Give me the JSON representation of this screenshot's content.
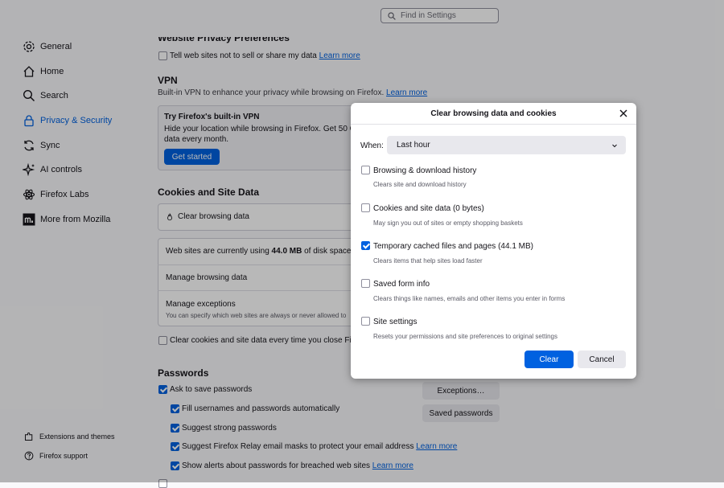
{
  "search": {
    "placeholder": "Find in Settings"
  },
  "sidebar": {
    "items": [
      {
        "label": "General",
        "icon": "gear-icon"
      },
      {
        "label": "Home",
        "icon": "home-icon"
      },
      {
        "label": "Search",
        "icon": "search-icon"
      },
      {
        "label": "Privacy & Security",
        "icon": "lock-icon",
        "active": true
      },
      {
        "label": "Sync",
        "icon": "sync-icon"
      },
      {
        "label": "AI controls",
        "icon": "sparkle-icon"
      },
      {
        "label": "Firefox Labs",
        "icon": "labs-icon"
      },
      {
        "label": "More from Mozilla",
        "icon": "mozilla-icon"
      }
    ],
    "footer": [
      {
        "label": "Extensions and themes",
        "icon": "puzzle-icon"
      },
      {
        "label": "Firefox support",
        "icon": "help-icon"
      }
    ]
  },
  "main": {
    "gpc_heading": "Website Privacy Preferences",
    "gpc_label": "Tell web sites not to sell or share my data",
    "learn_more": "Learn more",
    "vpn": {
      "heading": "VPN",
      "desc": "Built-in VPN to enhance your privacy while browsing on Firefox.",
      "promo_title": "Try Firefox's built-in VPN",
      "promo_line1": "Hide your location while browsing in Firefox. Get 50 GB",
      "promo_line2": "data every month.",
      "get_started": "Get started"
    },
    "cookies": {
      "heading": "Cookies and Site Data",
      "clear_label": "Clear browsing data",
      "usage_pre": "Web sites are currently using ",
      "usage_value": "44.0 MB",
      "usage_post": " of disk space.",
      "manage": "Manage browsing data",
      "exceptions_title": "Manage exceptions",
      "exceptions_desc": "You can specify which web sites are always or never allowed to",
      "clear_on_close": "Clear cookies and site data every time you close Firefox"
    },
    "passwords": {
      "heading": "Passwords",
      "ask_save": "Ask to save passwords",
      "fill": "Fill usernames and passwords automatically",
      "suggest": "Suggest strong passwords",
      "relay": "Suggest Firefox Relay email masks to protect your email address",
      "breach": "Show alerts about passwords for breached web sites",
      "exceptions_btn": "Exceptions…",
      "saved_btn": "Saved passwords"
    }
  },
  "dialog": {
    "title": "Clear browsing data and cookies",
    "when_label": "When:",
    "when_value": "Last hour",
    "options": [
      {
        "label": "Browsing & download history",
        "desc": "Clears site and download history",
        "checked": false
      },
      {
        "label": "Cookies and site data (0 bytes)",
        "desc": "May sign you out of sites or empty shopping baskets",
        "checked": false
      },
      {
        "label": "Temporary cached files and pages (44.1 MB)",
        "desc": "Clears items that help sites load faster",
        "checked": true
      },
      {
        "label": "Saved form info",
        "desc": "Clears things like names, emails and other items you enter in forms",
        "checked": false
      },
      {
        "label": "Site settings",
        "desc": "Resets your permissions and site preferences to original settings",
        "checked": false
      }
    ],
    "clear_btn": "Clear",
    "cancel_btn": "Cancel"
  },
  "colors": {
    "accent": "#0061e0",
    "overlay": "rgba(0,0,0,0.28)"
  }
}
